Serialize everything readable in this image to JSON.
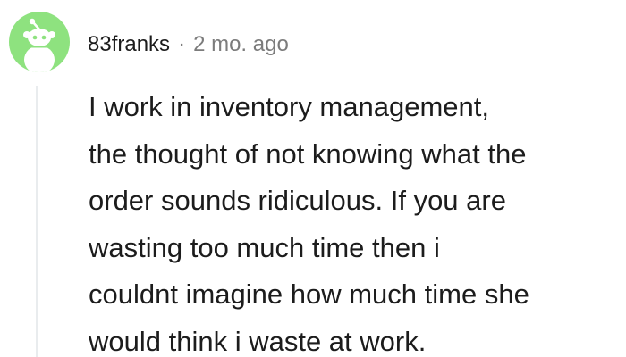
{
  "comment": {
    "username": "83franks",
    "separator": "·",
    "timestamp": "2 mo. ago",
    "body_lines": [
      "I work in inventory management,",
      "the thought of not knowing what the",
      "order sounds ridiculous. If you are",
      "wasting too much time then i",
      "couldnt imagine how much time she",
      "would think i waste at work."
    ]
  },
  "colors": {
    "avatar_bg": "#8ee27f",
    "avatar_figure": "#ffffff",
    "thread_line": "#e9ecee",
    "meta_text": "#7c7c7c",
    "body_text": "#1c1c1c"
  },
  "icons": {
    "avatar": "snoo-avatar-icon"
  }
}
